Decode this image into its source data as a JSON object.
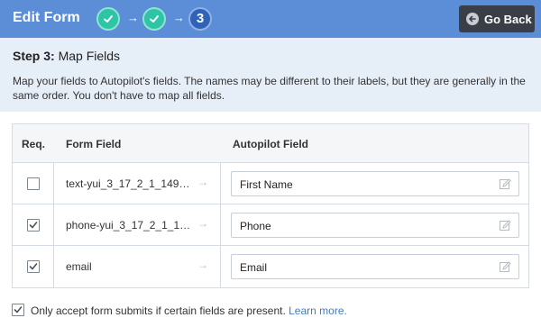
{
  "header": {
    "title": "Edit Form",
    "steps": [
      {
        "state": "done"
      },
      {
        "state": "done"
      },
      {
        "state": "current",
        "label": "3"
      }
    ],
    "go_back_label": "Go Back"
  },
  "step": {
    "prefix": "Step 3:",
    "title": " Map Fields",
    "description": "Map your fields to Autopilot's fields. The names may be different to their labels, but they are generally in the same order. You don't have to map all fields."
  },
  "table": {
    "columns": [
      "Req.",
      "Form Field",
      "Autopilot Field"
    ],
    "rows": [
      {
        "required": false,
        "form_field": "text-yui_3_17_2_1_149…",
        "autopilot_field": "First Name"
      },
      {
        "required": true,
        "form_field": "phone-yui_3_17_2_1_1…",
        "autopilot_field": "Phone"
      },
      {
        "required": true,
        "form_field": "email",
        "autopilot_field": "Email"
      }
    ]
  },
  "footer": {
    "checked": true,
    "text": "Only accept form submits if certain fields are present.",
    "link": "Learn more."
  },
  "colors": {
    "header_bg": "#5b8ed6",
    "step_done": "#2ec4a6",
    "step_current": "#2f63b8",
    "panel_bg": "#e6eef8",
    "link": "#3a7fd0"
  }
}
